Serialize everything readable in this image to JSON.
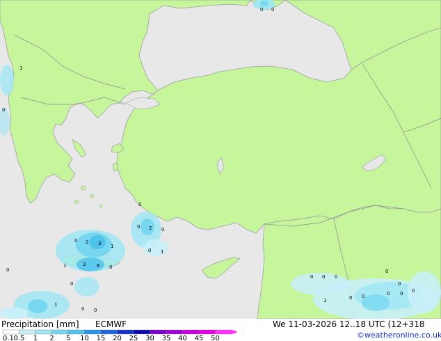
{
  "legend": {
    "title": "Precipitation [mm]",
    "model": "ECMWF",
    "colorbar": [
      {
        "label": "0.1",
        "color": "#ffffff"
      },
      {
        "label": "0.5",
        "color": "#c8f0f8"
      },
      {
        "label": "1",
        "color": "#a0e6f5"
      },
      {
        "label": "2",
        "color": "#78d7f0"
      },
      {
        "label": "5",
        "color": "#50c3eb"
      },
      {
        "label": "10",
        "color": "#2896e6"
      },
      {
        "label": "15",
        "color": "#1e64dc"
      },
      {
        "label": "20",
        "color": "#1432c8"
      },
      {
        "label": "25",
        "color": "#0a0aaa"
      },
      {
        "label": "30",
        "color": "#7800c8"
      },
      {
        "label": "35",
        "color": "#a000d2"
      },
      {
        "label": "40",
        "color": "#c800dc"
      },
      {
        "label": "45",
        "color": "#e600e6"
      },
      {
        "label": "50",
        "color": "#ff32ff"
      }
    ]
  },
  "valid_time": "We 11-03-2026 12..18 UTC (12+318",
  "credit": "©weatheronline.co.uk",
  "colors": {
    "land": "#c6f59b",
    "sea": "#e8e8e8",
    "coast": "#9aa0a0",
    "border": "#8c8c8c"
  },
  "precip_labels": [
    {
      "id": "black-sea-a",
      "text": "0"
    },
    {
      "id": "black-sea-b",
      "text": "0"
    },
    {
      "id": "albania-1",
      "text": "1"
    },
    {
      "id": "albania-0",
      "text": "0"
    },
    {
      "id": "bosporus-0",
      "text": "0"
    },
    {
      "id": "rhodes-0a",
      "text": "0"
    },
    {
      "id": "rhodes-2",
      "text": "2"
    },
    {
      "id": "rhodes-0b",
      "text": "0"
    },
    {
      "id": "rhodes-0c",
      "text": "0"
    },
    {
      "id": "rhodes-1",
      "text": "1"
    },
    {
      "id": "crete-0a",
      "text": "0"
    },
    {
      "id": "crete-2",
      "text": "2"
    },
    {
      "id": "crete-3a",
      "text": "3"
    },
    {
      "id": "crete-1a",
      "text": "1"
    },
    {
      "id": "crete-1b",
      "text": "1"
    },
    {
      "id": "crete-3b",
      "text": "3"
    },
    {
      "id": "crete-6",
      "text": "6"
    },
    {
      "id": "crete-0b",
      "text": "0"
    },
    {
      "id": "ionian-0",
      "text": "0"
    },
    {
      "id": "libyan-0a",
      "text": "0"
    },
    {
      "id": "libyan-1",
      "text": "1"
    },
    {
      "id": "libyan-0b",
      "text": "0"
    },
    {
      "id": "libyan-0c",
      "text": "0"
    },
    {
      "id": "cyprus-e-0a",
      "text": "0"
    },
    {
      "id": "cyprus-e-0b",
      "text": "0"
    },
    {
      "id": "cyprus-e-0c",
      "text": "0"
    },
    {
      "id": "levant-0a",
      "text": "0"
    },
    {
      "id": "levant-0b",
      "text": "0"
    },
    {
      "id": "levant-1",
      "text": "1"
    },
    {
      "id": "levant-0c",
      "text": "0"
    },
    {
      "id": "levant-0d",
      "text": "0"
    },
    {
      "id": "levant-0e",
      "text": "0"
    },
    {
      "id": "levant-0f",
      "text": "0"
    },
    {
      "id": "levant-0g",
      "text": "0"
    }
  ]
}
